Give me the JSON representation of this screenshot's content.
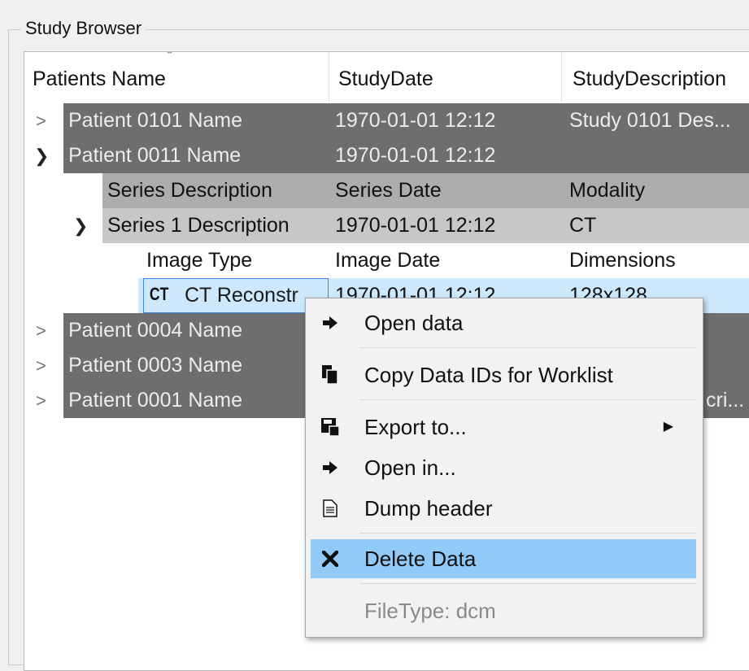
{
  "groupbox": {
    "title": "Study Browser"
  },
  "tree": {
    "columns": [
      "Patients Name",
      "StudyDate",
      "StudyDescription"
    ],
    "patients": [
      {
        "name": "Patient 0101 Name",
        "date": "1970-01-01 12:12",
        "desc": "Study 0101 Des..."
      },
      {
        "name": "Patient 0011 Name",
        "date": "1970-01-01 12:12",
        "desc": ""
      },
      {
        "name": "Patient 0004 Name",
        "date": "",
        "desc": ""
      },
      {
        "name": "Patient 0003 Name",
        "date": "",
        "desc": ""
      },
      {
        "name": "Patient 0001 Name",
        "date": "",
        "desc": "cri..."
      }
    ],
    "series_header": [
      "Series Description",
      "Series Date",
      "Modality"
    ],
    "series": {
      "desc": "Series 1 Description",
      "date": "1970-01-01 12:12",
      "modality": "CT"
    },
    "image_header": [
      "Image Type",
      "Image Date",
      "Dimensions"
    ],
    "image": {
      "badge": "CT",
      "type": "CT Reconstr",
      "date": "1970-01-01 12:12",
      "dims": "128x128"
    }
  },
  "context_menu": {
    "items": [
      {
        "label": "Open data",
        "icon": "arrow-right-icon"
      },
      {
        "label": "Copy Data IDs for Worklist",
        "icon": "copy-icon"
      },
      {
        "label": "Export to...",
        "icon": "save-icon",
        "submenu": true
      },
      {
        "label": "Open in...",
        "icon": "arrow-right-icon"
      },
      {
        "label": "Dump header",
        "icon": "document-icon"
      },
      {
        "label": "Delete Data",
        "icon": "delete-x-icon",
        "highlighted": true
      },
      {
        "label": "FileType: dcm",
        "disabled": true
      }
    ]
  },
  "colors": {
    "patient_row": "#6e6e6e",
    "menu_highlight": "#91c9f7",
    "selection": "#cde8fb"
  }
}
